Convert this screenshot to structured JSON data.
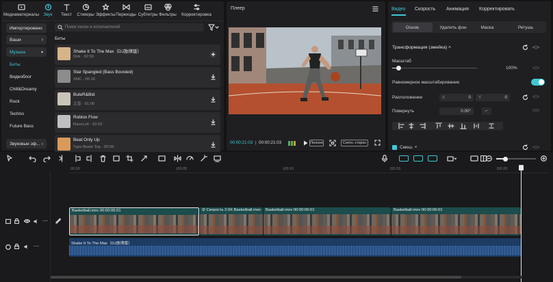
{
  "top_tabs": [
    {
      "label": "Медиаматериалы",
      "icon": "media-icon"
    },
    {
      "label": "Звук",
      "icon": "audio-icon",
      "active": true
    },
    {
      "label": "Текст",
      "icon": "text-icon"
    },
    {
      "label": "Стикеры",
      "icon": "sticker-icon"
    },
    {
      "label": "Эффекты",
      "icon": "effects-icon"
    },
    {
      "label": "Переходы",
      "icon": "transitions-icon"
    },
    {
      "label": "Субтитры",
      "icon": "subtitles-icon"
    },
    {
      "label": "Фильтры",
      "icon": "filters-icon"
    },
    {
      "label": "Корректировка",
      "icon": "adjust-icon"
    }
  ],
  "sidebar": {
    "import": "Импортировано",
    "yours": "Ваши",
    "music": "Музыка",
    "items": [
      "Биты",
      "Видеоблог",
      "Chill&Dreamy",
      "Rock",
      "Techno",
      "Future Bass"
    ],
    "sound_effects": "Звуковые эф..."
  },
  "search": {
    "placeholder": "Поиск песен и исполнителей"
  },
  "section_title": "Биты",
  "songs": [
    {
      "title": "Shake It To The Max（DJ放律版）",
      "artist": "Dirk · 02:59",
      "action": "add"
    },
    {
      "title": "Star Spangled (Bass Boosted)",
      "artist": "SNC · 00:16",
      "action": "download"
    },
    {
      "title": "BuleR&Bid",
      "artist": "之音 · 01:00",
      "action": "download"
    },
    {
      "title": "Roblox Flow",
      "artist": "RaveLofi · 02:02",
      "action": "download"
    },
    {
      "title": "Beat Only Up",
      "artist": "Type Beats Top · 00:55",
      "action": "download"
    }
  ],
  "player": {
    "title": "Плеер",
    "time_current": "00:00:21:03",
    "time_total": "00:00:21:03",
    "full_label": "Полное",
    "ratio_label": "Соотн. сторон"
  },
  "right_tabs": [
    "Видео",
    "Скорость",
    "Анимация",
    "Корректировать"
  ],
  "right_subtabs": [
    "Основ.",
    "Удалить фон",
    "Маска",
    "Ретушь"
  ],
  "properties": {
    "transform": "Трансформация (змейка)",
    "scale_label": "Масштаб",
    "scale_value": "100%",
    "scale_fraction": 0.08,
    "uniform_label": "Равномерное масштабирование",
    "position_label": "Расположение",
    "x_label": "X",
    "x_value": "0",
    "y_label": "Y",
    "y_value": "0",
    "rotate_label": "Повернуть",
    "rotate_value": "0.00°",
    "blend_label": "Смеш."
  },
  "ruler": [
    "00:00",
    "|00:05",
    "|00:10",
    "|00:15",
    "|00:20"
  ],
  "timeline": {
    "clips": [
      {
        "label": "Basketball.mov  00:00:06:01"
      },
      {
        "label": "⊘ Скорость 2.0X   Basketball.mov"
      },
      {
        "label": "Basketball.mov  00:00:06:01"
      },
      {
        "label": "Basketball.mov  00:00:06:01"
      }
    ],
    "audio_label": "Shake It To The Max（DJ放律版）"
  },
  "colors": {
    "accent": "#3fc8d3",
    "panel": "#1f1f22",
    "background": "#141414"
  }
}
